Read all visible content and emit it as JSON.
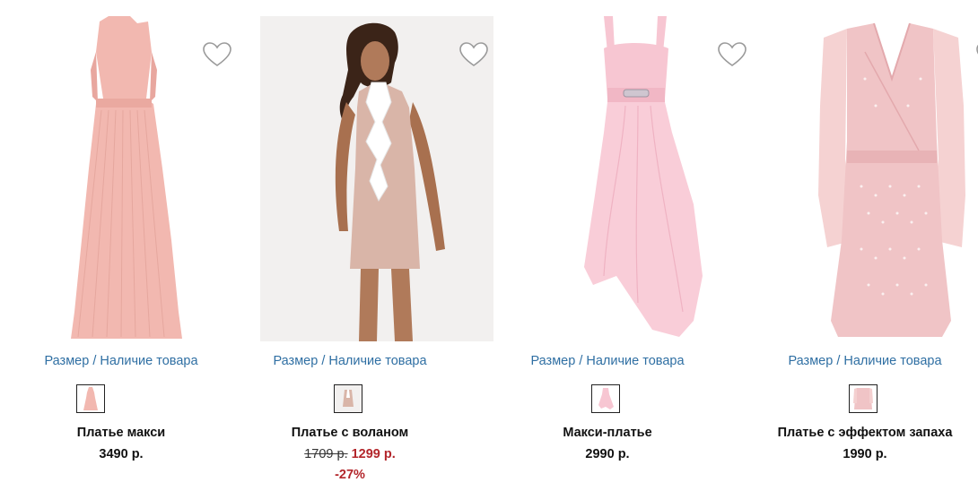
{
  "products": [
    {
      "name": "Платье макси",
      "size_link": "Размер / Наличие товара",
      "price": "3490 р.",
      "color": "#f2b8b0",
      "favorite_icon": "heart-outline-icon"
    },
    {
      "name": "Платье с воланом",
      "size_link": "Размер / Наличие товара",
      "old_price": "1709 р.",
      "price": "1299 р.",
      "discount": "-27%",
      "color": "#d9b5a8",
      "favorite_icon": "heart-outline-icon"
    },
    {
      "name": "Макси-платье",
      "size_link": "Размер / Наличие товара",
      "price": "2990 р.",
      "color": "#f7c6d2",
      "favorite_icon": "heart-outline-icon"
    },
    {
      "name": "Платье с эффектом запаха",
      "size_link": "Размер / Наличие товара",
      "price": "1990 р.",
      "color": "#f0c4c6",
      "favorite_icon": "heart-outline-icon"
    }
  ]
}
